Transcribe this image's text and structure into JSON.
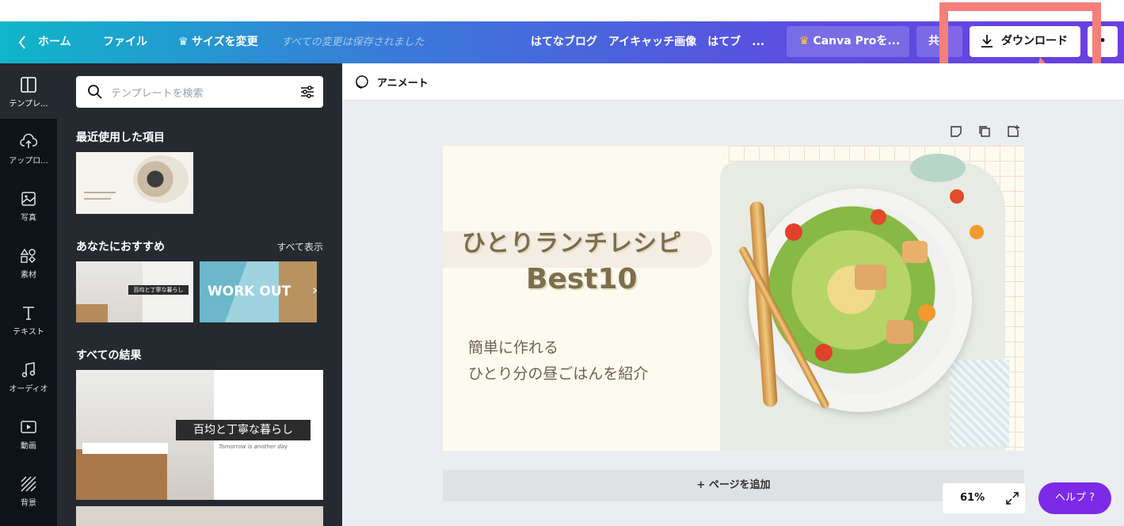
{
  "topbar": {
    "home": "ホーム",
    "file": "ファイル",
    "resize": "サイズを変更",
    "saved_status": "すべての変更は保存されました",
    "doc_title": "はてなブログ　アイキャッチ画像　はてブ　...",
    "pro_button": "Canva Proを...",
    "share_button": "共",
    "download_button": "ダウンロード",
    "more_button": "•"
  },
  "rail": {
    "items": [
      {
        "label": "テンプレ...",
        "icon": "layout-icon"
      },
      {
        "label": "アップロ...",
        "icon": "cloud-upload-icon"
      },
      {
        "label": "写真",
        "icon": "image-icon"
      },
      {
        "label": "素材",
        "icon": "shapes-icon"
      },
      {
        "label": "テキスト",
        "icon": "text-icon"
      },
      {
        "label": "オーディオ",
        "icon": "music-icon"
      },
      {
        "label": "動画",
        "icon": "video-icon"
      },
      {
        "label": "背景",
        "icon": "background-icon"
      }
    ]
  },
  "panel": {
    "search_placeholder": "テンプレートを検索",
    "recent_heading": "最近使用した項目",
    "recommend_heading": "あなたにおすすめ",
    "show_all": "すべて表示",
    "all_results_heading": "すべての結果",
    "thumb1_text": "百均と丁寧な暮らし",
    "thumb2_text": "WORK OUT",
    "thumb3_text": "百均と丁寧な暮らし",
    "thumb3_sub": "Tomorrow is another day"
  },
  "editor": {
    "animate_label": "アニメート",
    "add_page": "+ ページを追加",
    "zoom": "61%",
    "help": "ヘルプ ?"
  },
  "design": {
    "title_line1": "ひとりランチレシピ",
    "title_line2": "Best10",
    "sub_line1": "簡単に作れる",
    "sub_line2": "ひとり分の昼ごはんを紹介"
  },
  "colors": {
    "accent_purple": "#7d2ae8",
    "highlight": "#f67f7a",
    "panel_bg": "#252a31"
  }
}
